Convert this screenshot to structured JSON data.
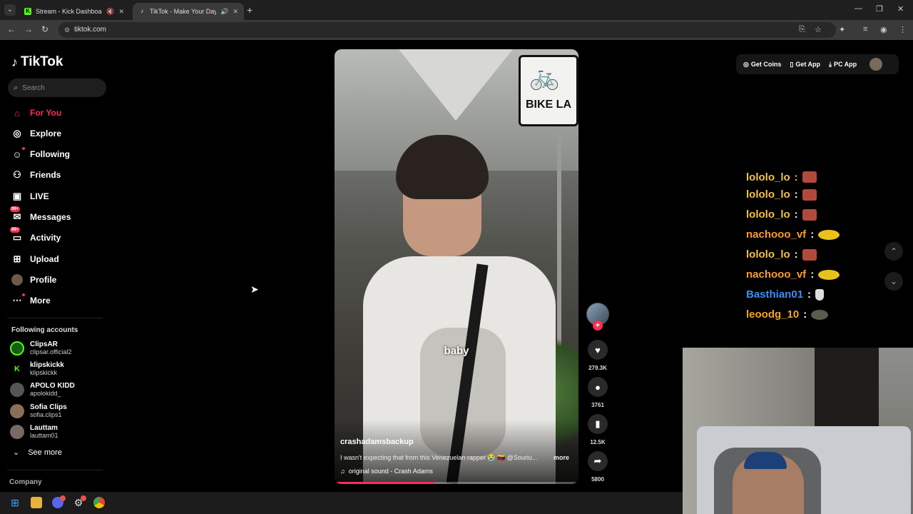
{
  "browser": {
    "tabs": [
      {
        "label": "Stream - Kick Dashboard",
        "favicon": "kick-icon"
      },
      {
        "label": "TikTok - Make Your Day",
        "favicon": "tiktok-icon"
      }
    ],
    "url": "tiktok.com"
  },
  "brand": {
    "name": "TikTok",
    "accent": "#fe2c55"
  },
  "search": {
    "placeholder": "Search"
  },
  "nav": [
    {
      "label": "For You",
      "icon": "home-icon",
      "active": true
    },
    {
      "label": "Explore",
      "icon": "compass-icon"
    },
    {
      "label": "Following",
      "icon": "following-icon"
    },
    {
      "label": "Friends",
      "icon": "friends-icon"
    },
    {
      "label": "LIVE",
      "icon": "live-icon"
    },
    {
      "label": "Messages",
      "icon": "messages-icon",
      "badge": "99+"
    },
    {
      "label": "Activity",
      "icon": "activity-icon",
      "badge": "99+"
    },
    {
      "label": "Upload",
      "icon": "upload-icon"
    },
    {
      "label": "Profile",
      "icon": "profile-icon"
    },
    {
      "label": "More",
      "icon": "more-icon"
    }
  ],
  "following_accounts": {
    "title": "Following accounts",
    "accounts": [
      {
        "name": "ClipsAR",
        "handle": "clipsar.official2"
      },
      {
        "name": "klipskickk",
        "handle": "klipskickk"
      },
      {
        "name": "APOLO KIDD",
        "handle": "apolokidd_"
      },
      {
        "name": "Sofia Clips",
        "handle": "sofia.clips1"
      },
      {
        "name": "Lauttam",
        "handle": "lauttam01"
      }
    ],
    "see_more": "See more"
  },
  "footer": {
    "company": "Company"
  },
  "video": {
    "caption": "baby",
    "sign_text": "BIKE LA",
    "author": "crashadamsbackup",
    "description": "I wasn't expecting that from this Venezuelan rapper 😭 🇻🇪 @Souriu...",
    "more": "more",
    "sound": "original sound - Crash Adams",
    "progress": 0.41
  },
  "actions": {
    "likes": "279.3K",
    "comments": "3761",
    "saves": "12.5K",
    "shares": "5800"
  },
  "top_right": {
    "get_coins": "Get Coins",
    "get_app": "Get App",
    "pc_app": "PC App"
  },
  "chat": [
    {
      "user": "lololo_lo",
      "color": "#f5c243",
      "emote": "red"
    },
    {
      "user": "lololo_lo",
      "color": "#f5c243",
      "emote": "red"
    },
    {
      "user": "nachooo_vf",
      "color": "#f59e2b",
      "emote": "coin"
    },
    {
      "user": "lololo_lo",
      "color": "#f5c243",
      "emote": "red"
    },
    {
      "user": "nachooo_vf",
      "color": "#f59e2b",
      "emote": "coin"
    },
    {
      "user": "Basthian01",
      "color": "#3d8ef0",
      "emote": "tag"
    },
    {
      "user": "leoodg_10",
      "color": "#f5a623",
      "emote": "cat"
    }
  ],
  "chat_partial": "lololo_lo",
  "chat_separator": ":"
}
